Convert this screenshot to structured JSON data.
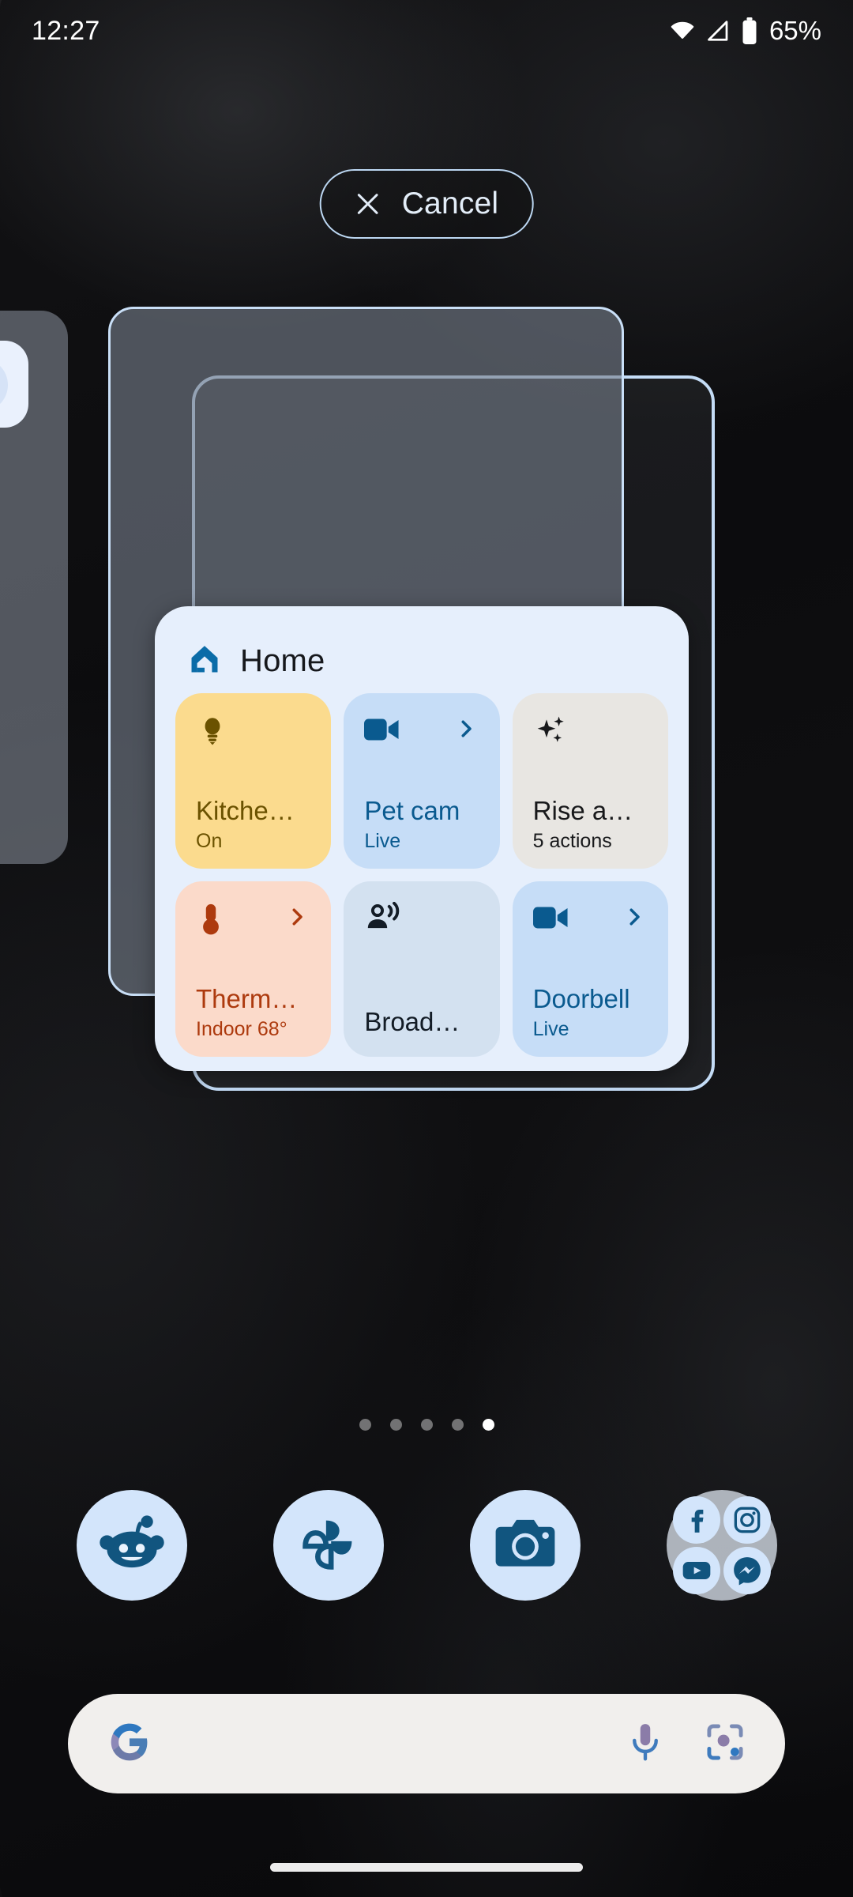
{
  "statusbar": {
    "time": "12:27",
    "battery_percent": "65%",
    "icons": [
      "wifi-icon",
      "cellular-signal-icon",
      "battery-icon"
    ]
  },
  "cancel_button": {
    "label": "Cancel",
    "icon": "close-icon"
  },
  "widget": {
    "app_icon": "google-home-icon",
    "title": "Home",
    "background_color": "#e6effc",
    "tiles": [
      {
        "name": "Kitche…",
        "subtitle": "On",
        "icon": "lightbulb-icon",
        "chevron": false,
        "bg": "#fbdb8e",
        "fg": "#6b5200",
        "theme": "t-yellow"
      },
      {
        "name": "Pet cam",
        "subtitle": "Live",
        "icon": "videocam-icon",
        "chevron": true,
        "bg": "#c6ddf7",
        "fg": "#0a5a8f",
        "theme": "t-blue"
      },
      {
        "name": "Rise a…",
        "subtitle": "5 actions",
        "icon": "sparkle-icon",
        "chevron": false,
        "bg": "#e8e6e2",
        "fg": "#18191b",
        "theme": "t-gray"
      },
      {
        "name": "Therm…",
        "subtitle": "Indoor 68°",
        "icon": "thermometer-icon",
        "chevron": true,
        "bg": "#fbdaca",
        "fg": "#ad3a0e",
        "theme": "t-peach"
      },
      {
        "name": "Broad…",
        "subtitle": "",
        "icon": "broadcast-icon",
        "chevron": false,
        "bg": "#d3e1f0",
        "fg": "#131c26",
        "theme": "t-slate"
      },
      {
        "name": "Doorbell",
        "subtitle": "Live",
        "icon": "videocam-icon",
        "chevron": true,
        "bg": "#c6ddf7",
        "fg": "#0a5a8f",
        "theme": "t-blue"
      }
    ]
  },
  "page_indicator": {
    "count": 5,
    "active_index": 4
  },
  "dock": {
    "apps": [
      {
        "name": "Reddit",
        "icon": "reddit-icon"
      },
      {
        "name": "Google Photos",
        "icon": "google-photos-icon"
      },
      {
        "name": "Camera",
        "icon": "camera-icon"
      }
    ],
    "folder": {
      "name": "Social folder",
      "icons": [
        "facebook-icon",
        "instagram-icon",
        "youtube-icon",
        "messenger-icon"
      ]
    }
  },
  "search": {
    "placeholder": "",
    "value": "",
    "logo": "google-g-icon",
    "mic": "microphone-icon",
    "lens": "google-lens-icon"
  },
  "navigation": {
    "handle": "gesture-home-handle"
  },
  "colors": {
    "accent_border": "#c9dff7",
    "widget_bg": "#e6effc",
    "dock_icon_bg": "#d3e5fb",
    "search_bg": "#f1efed",
    "blue_fg": "#0a5a8f"
  }
}
